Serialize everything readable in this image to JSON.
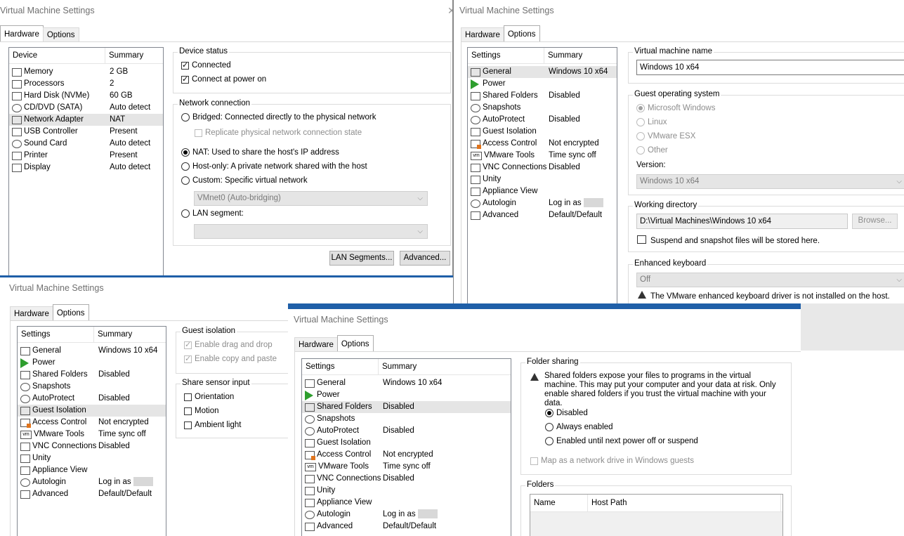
{
  "shared": {
    "title": "Virtual Machine Settings",
    "tab_hardware": "Hardware",
    "tab_options": "Options",
    "col_settings": "Settings",
    "col_summary": "Summary"
  },
  "win1": {
    "list_head": [
      "Device",
      "Summary"
    ],
    "devices": [
      {
        "name": "Memory",
        "summary": "2 GB",
        "icon": "memory-icon"
      },
      {
        "name": "Processors",
        "summary": "2",
        "icon": "processor-icon"
      },
      {
        "name": "Hard Disk (NVMe)",
        "summary": "60 GB",
        "icon": "hard-disk-icon"
      },
      {
        "name": "CD/DVD (SATA)",
        "summary": "Auto detect",
        "icon": "cd-dvd-icon"
      },
      {
        "name": "Network Adapter",
        "summary": "NAT",
        "icon": "network-adapter-icon"
      },
      {
        "name": "USB Controller",
        "summary": "Present",
        "icon": "usb-icon"
      },
      {
        "name": "Sound Card",
        "summary": "Auto detect",
        "icon": "sound-card-icon"
      },
      {
        "name": "Printer",
        "summary": "Present",
        "icon": "printer-icon"
      },
      {
        "name": "Display",
        "summary": "Auto detect",
        "icon": "display-icon"
      }
    ],
    "device_status": "Device status",
    "connected": "Connected",
    "connect_power": "Connect at power on",
    "network_connection": "Network connection",
    "bridged": "Bridged: Connected directly to the physical network",
    "replicate": "Replicate physical network connection state",
    "nat": "NAT: Used to share the host's IP address",
    "hostonly": "Host-only: A private network shared with the host",
    "custom": "Custom: Specific virtual network",
    "vmnet": "VMnet0 (Auto-bridging)",
    "lan": "LAN segment:",
    "lan_segments_btn": "LAN Segments...",
    "advanced_btn": "Advanced..."
  },
  "options_list": [
    {
      "name": "General",
      "summary": "Windows 10 x64",
      "icon": "general-icon"
    },
    {
      "name": "Power",
      "summary": "",
      "icon": "power-icon"
    },
    {
      "name": "Shared Folders",
      "summary": "Disabled",
      "icon": "shared-folders-icon"
    },
    {
      "name": "Snapshots",
      "summary": "",
      "icon": "snapshots-icon"
    },
    {
      "name": "AutoProtect",
      "summary": "Disabled",
      "icon": "autoprotect-icon"
    },
    {
      "name": "Guest Isolation",
      "summary": "",
      "icon": "guest-isolation-icon"
    },
    {
      "name": "Access Control",
      "summary": "Not encrypted",
      "icon": "access-control-icon"
    },
    {
      "name": "VMware Tools",
      "summary": "Time sync off",
      "icon": "vmware-tools-icon"
    },
    {
      "name": "VNC Connections",
      "summary": "Disabled",
      "icon": "vnc-icon"
    },
    {
      "name": "Unity",
      "summary": "",
      "icon": "unity-icon"
    },
    {
      "name": "Appliance View",
      "summary": "",
      "icon": "appliance-view-icon"
    },
    {
      "name": "Autologin",
      "summary": "Log in as",
      "icon": "autologin-icon"
    },
    {
      "name": "Advanced",
      "summary": "Default/Default",
      "icon": "advanced-icon"
    }
  ],
  "win2": {
    "vm_name_label": "Virtual machine name",
    "vm_name": "Windows 10 x64",
    "guest_os": "Guest operating system",
    "os_windows": "Microsoft Windows",
    "os_linux": "Linux",
    "os_esx": "VMware ESX",
    "os_other": "Other",
    "version_label": "Version:",
    "version": "Windows 10 x64",
    "workdir_label": "Working directory",
    "workdir": "D:\\Virtual Machines\\Windows 10 x64",
    "browse": "Browse...",
    "workdir_note": "Suspend and snapshot files will be stored here.",
    "enh_kb": "Enhanced keyboard",
    "enh_kb_value": "Off",
    "enh_kb_warn": "The VMware enhanced keyboard driver is not installed on the host."
  },
  "win3": {
    "guest_isolation": "Guest isolation",
    "drag_drop": "Enable drag and drop",
    "copy_paste": "Enable copy and paste",
    "sensor": "Share sensor input",
    "orientation": "Orientation",
    "motion": "Motion",
    "ambient": "Ambient light"
  },
  "win4": {
    "folder_sharing": "Folder sharing",
    "warning": "Shared folders expose your files to programs in the virtual machine. This may put your computer and your data at risk. Only enable shared folders if you trust the virtual machine with your data.",
    "disabled": "Disabled",
    "always": "Always enabled",
    "until": "Enabled until next power off or suspend",
    "map_drive": "Map as a network drive in Windows guests",
    "folders": "Folders",
    "col_name": "Name",
    "col_host": "Host Path"
  }
}
